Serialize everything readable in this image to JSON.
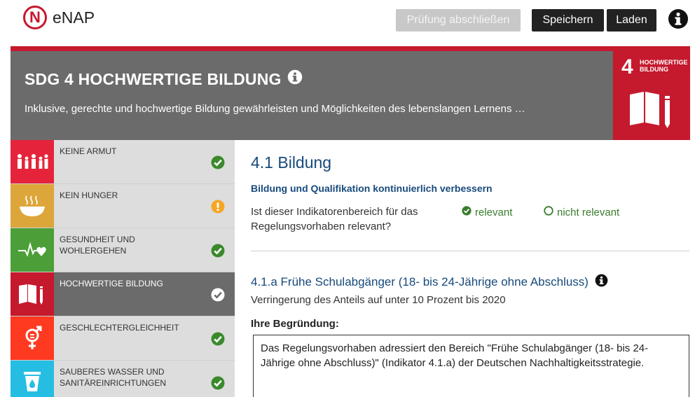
{
  "app": {
    "logo_letter": "N",
    "name": "eNAP"
  },
  "toolbar": {
    "finish_label": "Prüfung abschließen",
    "save_label": "Speichern",
    "load_label": "Laden",
    "info_icon": "info-circle-icon"
  },
  "banner": {
    "title": "SDG 4 HOCHWERTIGE BILDUNG",
    "subtitle": "Inklusive, gerechte und hochwertige Bildung gewährleisten und Möglichkeiten des lebenslangen Lernens …",
    "tile_number": "4",
    "tile_label_line1": "HOCHWERTIGE",
    "tile_label_line2": "BILDUNG",
    "tile_icon": "book-pencil-icon"
  },
  "sidebar": {
    "items": [
      {
        "label": "KEINE ARMUT",
        "status": "check",
        "color": "#e5243b",
        "icon": "family-icon"
      },
      {
        "label": "KEIN HUNGER",
        "status": "warning",
        "color": "#dda63a",
        "icon": "bowl-icon"
      },
      {
        "label": "GESUNDHEIT UND WOHLERGEHEN",
        "status": "check",
        "color": "#4c9f38",
        "icon": "heartbeat-icon"
      },
      {
        "label": "HOCHWERTIGE BILDUNG",
        "status": "check-active",
        "color": "#c5192d",
        "icon": "book-pencil-icon"
      },
      {
        "label": "GESCHLECHTERGLEICHHEIT",
        "status": "check",
        "color": "#ff3a21",
        "icon": "gender-icon"
      },
      {
        "label": "SAUBERES WASSER UND SANITÄREINRICHTUNGEN",
        "status": "check",
        "color": "#26bde2",
        "icon": "water-drop-icon"
      }
    ]
  },
  "main": {
    "section_title": "4.1 Bildung",
    "section_subtitle": "Bildung und Qualifikation kontinuierlich verbessern",
    "question": "Ist dieser Indikatorenbereich für das Regelungsvorhaben relevant?",
    "option_relevant": "relevant",
    "option_not_relevant": "nicht relevant",
    "selected_option": "relevant",
    "indicator_title": "4.1.a Frühe Schulabgänger (18- bis 24-Jährige ohne Abschluss)",
    "indicator_target": "Verringerung des Anteils auf unter 10 Prozent bis 2020",
    "reason_label": "Ihre Begründung:",
    "reason_text": "Das Regelungsvorhaben adressiert den Bereich \"Frühe Schulabgänger (18- bis 24-Jährige ohne Abschluss)\" (Indikator 4.1.a) der Deutschen Nachhaltigkeitsstrategie."
  },
  "colors": {
    "brand_red": "#c5192d",
    "banner_gray": "#6b6b6b",
    "link_blue": "#174a7c",
    "ok_green": "#3a8a2c",
    "warn_orange": "#f5a623"
  }
}
